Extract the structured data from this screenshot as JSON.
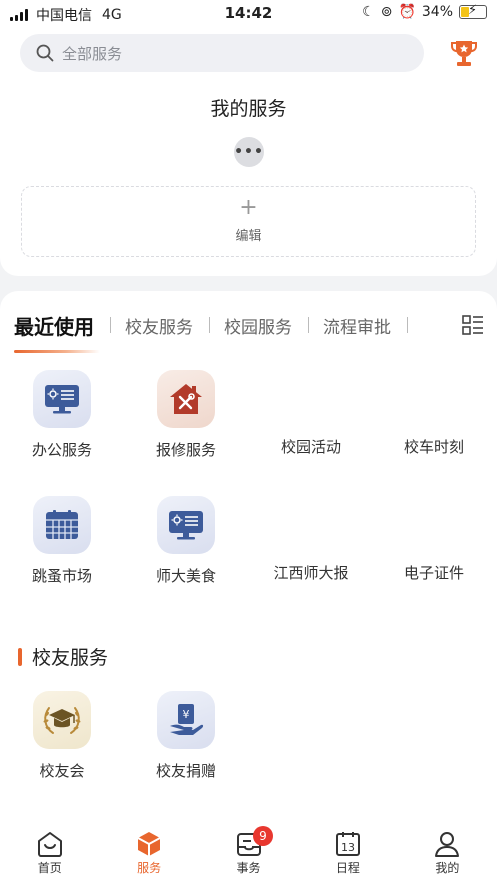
{
  "status": {
    "carrier": "中国电信",
    "network": "4G",
    "time": "14:42",
    "battery": "34%"
  },
  "search": {
    "placeholder": "全部服务"
  },
  "my_services": {
    "title": "我的服务",
    "edit_label": "编辑"
  },
  "tabs": [
    {
      "label": "最近使用",
      "active": true
    },
    {
      "label": "校友服务",
      "active": false
    },
    {
      "label": "校园服务",
      "active": false
    },
    {
      "label": "流程审批",
      "active": false
    }
  ],
  "recent": [
    {
      "label": "办公服务",
      "icon": "monitor-icon"
    },
    {
      "label": "报修服务",
      "icon": "repair-house-icon"
    },
    {
      "label": "校园活动",
      "icon": ""
    },
    {
      "label": "校车时刻",
      "icon": ""
    },
    {
      "label": "跳蚤市场",
      "icon": "calendar-grid-icon"
    },
    {
      "label": "师大美食",
      "icon": "monitor-icon"
    },
    {
      "label": "江西师大报",
      "icon": ""
    },
    {
      "label": "电子证件",
      "icon": ""
    }
  ],
  "alumni": {
    "title": "校友服务",
    "items": [
      {
        "label": "校友会",
        "icon": "graduation-laurel-icon"
      },
      {
        "label": "校友捐赠",
        "icon": "donation-icon"
      }
    ]
  },
  "nav": [
    {
      "label": "首页",
      "icon": "home-icon",
      "active": false
    },
    {
      "label": "服务",
      "icon": "cube-icon",
      "active": true
    },
    {
      "label": "事务",
      "icon": "inbox-icon",
      "active": false,
      "badge": "9"
    },
    {
      "label": "日程",
      "icon": "calendar-icon",
      "active": false,
      "date": "13"
    },
    {
      "label": "我的",
      "icon": "user-icon",
      "active": false
    }
  ],
  "colors": {
    "accent": "#e8662e",
    "badge": "#e8372f",
    "icon_blue": "#3d5b9a"
  }
}
